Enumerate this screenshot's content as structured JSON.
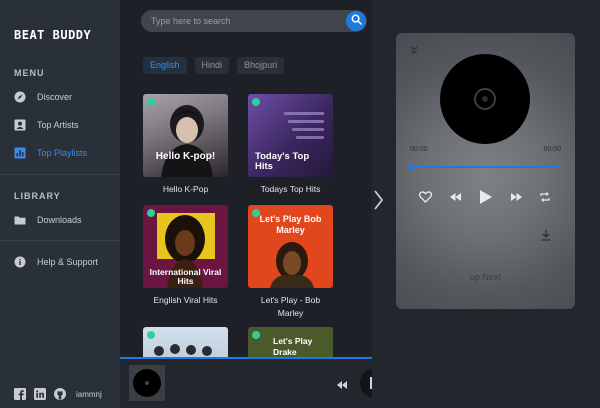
{
  "app": {
    "logo": "BEAT BUDDY"
  },
  "sidebar": {
    "menu_title": "MENU",
    "menu_items": [
      {
        "label": "Discover",
        "icon": "compass-icon",
        "active": false
      },
      {
        "label": "Top Artists",
        "icon": "portrait-icon",
        "active": false
      },
      {
        "label": "Top Playlists",
        "icon": "chart-icon",
        "active": true
      }
    ],
    "library_title": "LIBRARY",
    "library_items": [
      {
        "label": "Downloads",
        "icon": "folder-icon"
      }
    ],
    "help_item": {
      "label": "Help & Support",
      "icon": "info-icon"
    },
    "social": {
      "username": "iammnj",
      "icons": [
        "facebook-icon",
        "linkedin-icon",
        "github-icon"
      ]
    }
  },
  "search": {
    "placeholder": "Type here to search"
  },
  "languages": [
    {
      "label": "English",
      "active": true
    },
    {
      "label": "Hindi",
      "active": false
    },
    {
      "label": "Bhojpuri",
      "active": false
    }
  ],
  "playlists": [
    {
      "title": "Hello K-Pop",
      "art_text": "Hello K-pop!",
      "art_color": "#6f6a74"
    },
    {
      "title": "Todays Top Hits",
      "art_text": "Today's Top Hits",
      "art_color": "#3d2a63"
    },
    {
      "title": "English Viral Hits",
      "art_text": "International Viral Hits",
      "art_color": "#6a1640"
    },
    {
      "title": "Let's Play - Bob Marley",
      "art_text": "Let's Play Bob Marley",
      "art_color": "#e2461c"
    },
    {
      "title": "",
      "art_text": "",
      "art_color": "#b7c8d8"
    },
    {
      "title": "",
      "art_text": "Let's Play Drake",
      "art_color": "#4a5a2a"
    }
  ],
  "player": {
    "current_time": "00:00",
    "duration": "00:00",
    "progress": 0,
    "up_next_label": "up Next"
  },
  "colors": {
    "accent": "#1f7ae0",
    "sidebar_bg": "#2a3039",
    "main_bg": "#1d2127"
  }
}
